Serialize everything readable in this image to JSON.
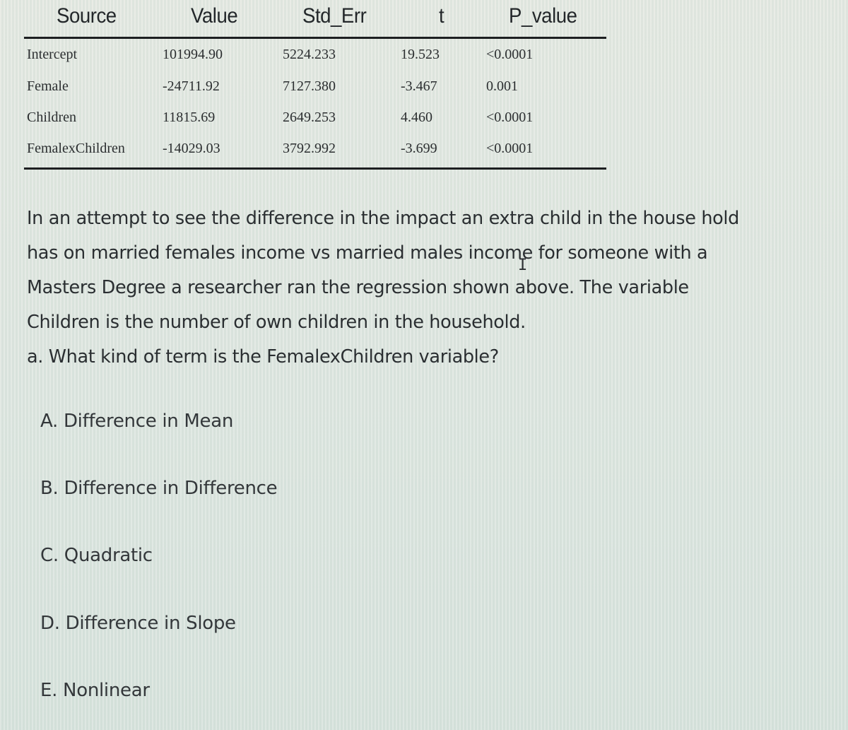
{
  "table": {
    "headers": [
      "Source",
      "Value",
      "Std_Err",
      "t",
      "P_value"
    ],
    "rows": [
      {
        "source": "Intercept",
        "value": "101994.90",
        "std_err": "5224.233",
        "t": "19.523",
        "p_value": "<0.0001"
      },
      {
        "source": "Female",
        "value": "-24711.92",
        "std_err": "7127.380",
        "t": "-3.467",
        "p_value": "0.001"
      },
      {
        "source": "Children",
        "value": "11815.69",
        "std_err": "2649.253",
        "t": "4.460",
        "p_value": "<0.0001"
      },
      {
        "source": "FemalexChildren",
        "value": "-14029.03",
        "std_err": "3792.992",
        "t": "-3.699",
        "p_value": "<0.0001"
      }
    ]
  },
  "question": {
    "lines": [
      "In an attempt to see the difference in the impact an extra child in the house hold",
      "has on married females income vs married males income for someone with a",
      "Masters Degree a researcher ran the regression shown above. The variable",
      "Children is the number of own children in the household.",
      "a. What kind of term is the FemalexChildren variable?"
    ]
  },
  "cursor": {
    "icon": "text-cursor-icon",
    "glyph": "I"
  },
  "options": [
    {
      "letter": "A",
      "label": "A. Difference in Mean"
    },
    {
      "letter": "B",
      "label": "B. Difference in Difference"
    },
    {
      "letter": "C",
      "label": "C. Quadratic"
    },
    {
      "letter": "D",
      "label": "D. Difference in Slope"
    },
    {
      "letter": "E",
      "label": "E. Nonlinear"
    }
  ]
}
